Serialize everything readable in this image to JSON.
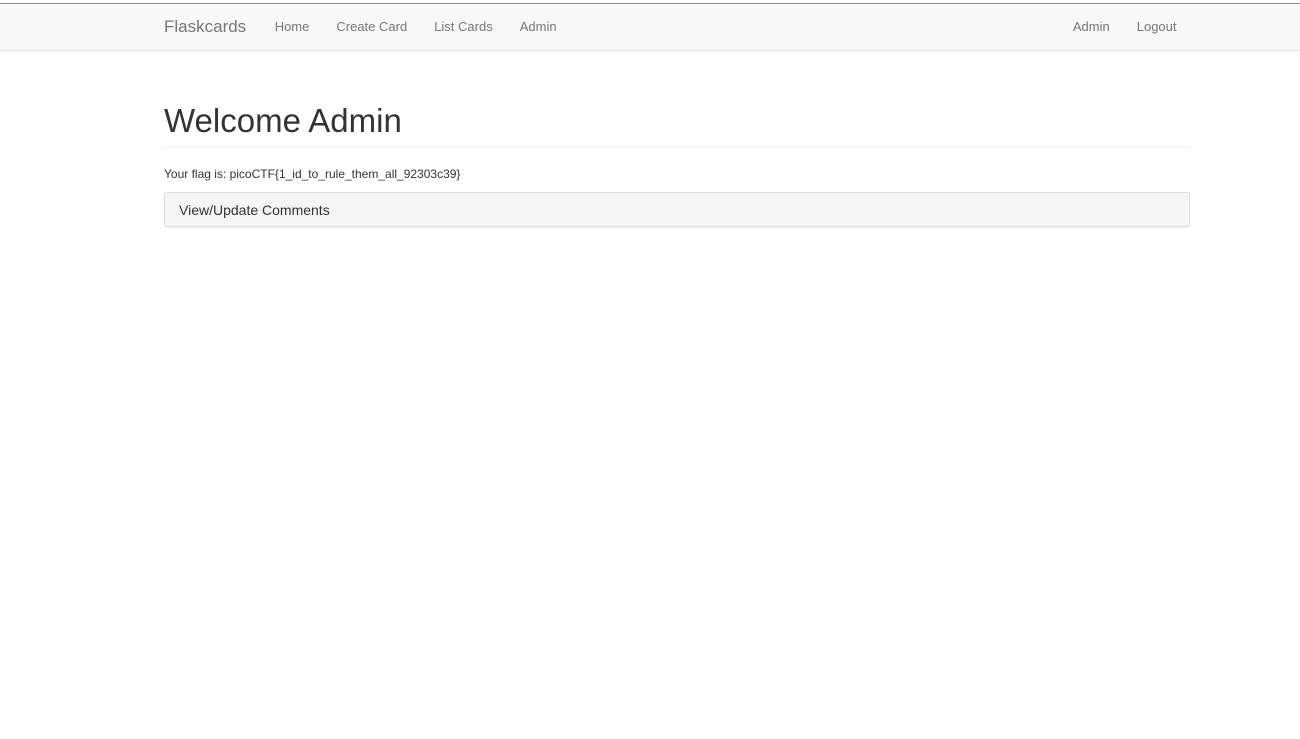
{
  "navbar": {
    "brand": "Flaskcards",
    "left_links": [
      "Home",
      "Create Card",
      "List Cards",
      "Admin"
    ],
    "right_links": [
      "Admin",
      "Logout"
    ]
  },
  "main": {
    "title": "Welcome Admin",
    "flag_text": "Your flag is: picoCTF{1_id_to_rule_them_all_92303c39}",
    "panel_title": "View/Update Comments"
  }
}
